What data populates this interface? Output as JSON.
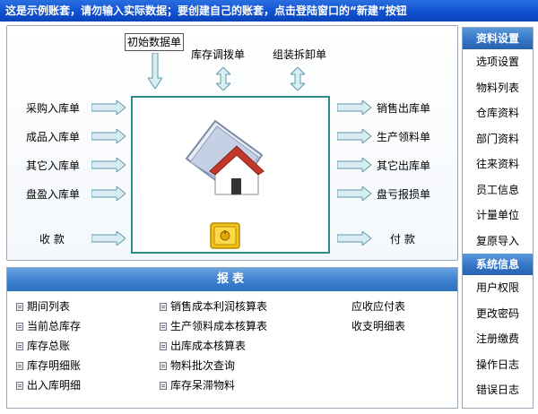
{
  "top_notice": "这是示例账套，请勿输入实际数据；要创建自己的账套，点击登陆窗口的“新建”按钮",
  "flow": {
    "initial": "初始数据单",
    "transfer": "库存调拨单",
    "assembly": "组装拆卸单",
    "left": [
      "采购入库单",
      "成品入库单",
      "其它入库单",
      "盘盈入库单",
      "收 款"
    ],
    "right": [
      "销售出库单",
      "生产领料单",
      "其它出库单",
      "盘亏报损单",
      "付 款"
    ]
  },
  "reports": {
    "title": "报表",
    "col1": [
      "期间列表",
      "当前总库存",
      "库存总账",
      "库存明细账",
      "出入库明细"
    ],
    "col2": [
      "销售成本利润核算表",
      "生产领料成本核算表",
      "出库成本核算表",
      "物料批次查询",
      "库存呆滞物料"
    ],
    "col3": [
      "应收应付表",
      "收支明细表"
    ]
  },
  "sidebar": {
    "section1_title": "资料设置",
    "section1_items": [
      "选项设置",
      "物料列表",
      "仓库资料",
      "部门资料",
      "往来资料",
      "员工信息",
      "计量单位",
      "复原导入"
    ],
    "section2_title": "系统信息",
    "section2_items": [
      "用户权限",
      "更改密码",
      "注册缴费",
      "操作日志",
      "错误日志"
    ]
  },
  "colors": {
    "title_bar": "#0f4fcf",
    "arrow_fill": "#d8ecf2",
    "arrow_stroke": "#5e9aae",
    "center_border": "#2e8b8b",
    "header_blue": "#3f82d1"
  }
}
